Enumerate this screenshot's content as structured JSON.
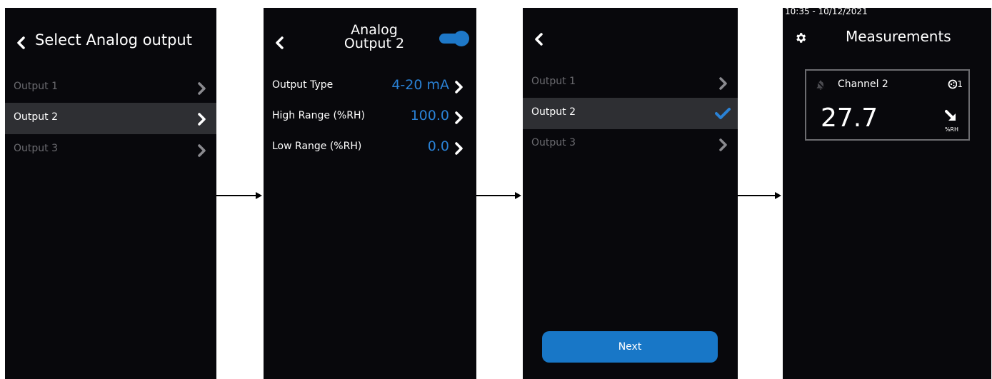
{
  "screen1": {
    "title": "Select Analog output",
    "outputs": [
      "Output 1",
      "Output 2",
      "Output 3"
    ],
    "selected": "Output 2"
  },
  "screen2": {
    "title_line1": "Analog",
    "title_line2": "Output 2",
    "enabled": true,
    "settings": [
      {
        "label": "Output Type",
        "value": "4-20 mA"
      },
      {
        "label": "High Range (%RH)",
        "value": "100.0"
      },
      {
        "label": "Low Range (%RH)",
        "value": "0.0"
      }
    ]
  },
  "screen3": {
    "outputs": [
      "Output 1",
      "Output 2",
      "Output 3"
    ],
    "selected": "Output 2",
    "next_label": "Next"
  },
  "screen4": {
    "datetime": "10:35 - 10/12/2021",
    "title": "Measurements",
    "channel": "Channel 2",
    "output_indicator": "1",
    "value": "27.7",
    "unit": "%RH"
  },
  "colors": {
    "accent": "#1e78c8",
    "value_blue": "#2a82d6",
    "background": "#08080c",
    "selected_row": "#2e2f33",
    "dim_text": "#6b6b70"
  }
}
